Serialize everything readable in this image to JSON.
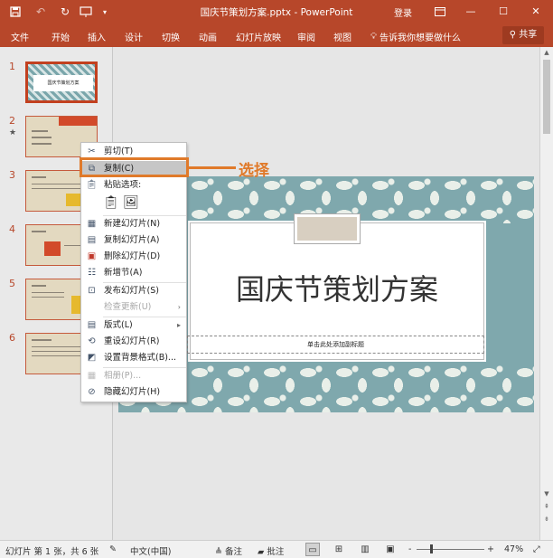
{
  "title_bar": {
    "title": "国庆节策划方案.pptx  -  PowerPoint",
    "login": "登录",
    "icons": [
      "save-icon",
      "undo-icon",
      "redo-icon",
      "start-presentation-icon",
      "customize-quick-access-icon"
    ]
  },
  "ribbon": {
    "tabs": [
      "文件",
      "开始",
      "插入",
      "设计",
      "切换",
      "动画",
      "幻灯片放映",
      "审阅",
      "视图"
    ],
    "tell_me": "告诉我你想要做什么",
    "share": "共享"
  },
  "thumbnails": {
    "numbers": [
      "1",
      "2",
      "3",
      "4",
      "5",
      "6"
    ],
    "star": "★",
    "slide1_text": "国庆节策划方案"
  },
  "slide": {
    "title": "国庆节策划方案",
    "subtitle_placeholder": "单击此处添加副标题"
  },
  "context_menu": {
    "cut": "剪切(T)",
    "copy": "复制(C)",
    "paste_options": "粘贴选项:",
    "new_slide": "新建幻灯片(N)",
    "duplicate_slide": "复制幻灯片(A)",
    "delete_slide": "删除幻灯片(D)",
    "add_section": "新增节(A)",
    "publish_slides": "发布幻灯片(S)",
    "check_updates": "检查更新(U)",
    "layout": "版式(L)",
    "reset_slide": "重设幻灯片(R)",
    "format_background": "设置背景格式(B)...",
    "photo_album": "相册(P)...",
    "hide_slide": "隐藏幻灯片(H)"
  },
  "annotation": {
    "label": "选择",
    "color": "#e07a2a"
  },
  "status_bar": {
    "slide_info": "幻灯片 第 1 张，共 6 张",
    "language": "中文(中国)",
    "notes": "备注",
    "comments": "批注",
    "zoom": "47%",
    "zoom_minus": "-",
    "zoom_plus": "+"
  },
  "colors": {
    "accent": "#b7472a",
    "slide_teal": "#7fa8ad"
  }
}
